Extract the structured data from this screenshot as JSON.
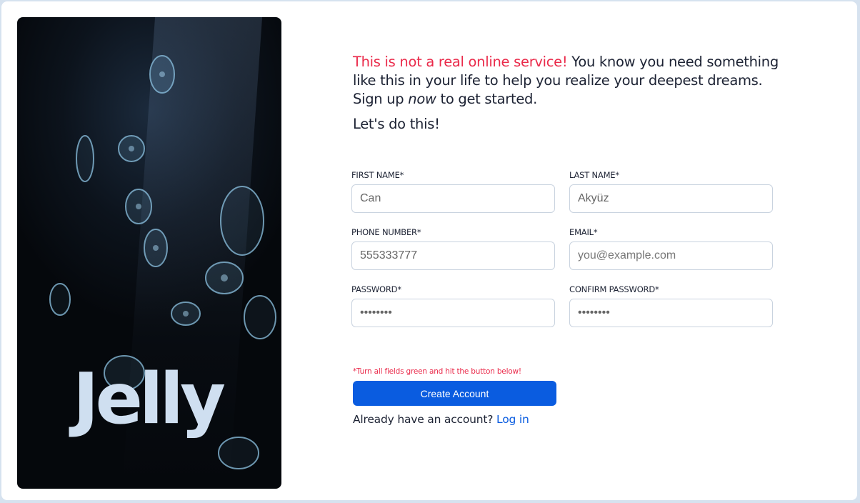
{
  "hero": {
    "brand": "Jelly",
    "image_alt": "jellyfish"
  },
  "intro": {
    "warning": "This is not a real online service!",
    "text_before_em": " You know you need something like this in your life to help you realize your deepest dreams. Sign up ",
    "em": "now",
    "text_after_em": " to get started.",
    "cta": "Let's do this!"
  },
  "form": {
    "first_name": {
      "label": "FIRST NAME*",
      "value": "Can",
      "placeholder": ""
    },
    "last_name": {
      "label": "LAST NAME*",
      "value": "Akyüz",
      "placeholder": ""
    },
    "phone": {
      "label": "PHONE NUMBER*",
      "value": "555333777",
      "placeholder": ""
    },
    "email": {
      "label": "EMAIL*",
      "value": "",
      "placeholder": "you@example.com"
    },
    "password": {
      "label": "PASSWORD*",
      "value": "********",
      "placeholder": ""
    },
    "confirm_password": {
      "label": "CONFIRM PASSWORD*",
      "value": "********",
      "placeholder": ""
    },
    "hint": "*Turn all fields green and hit the button below!",
    "submit_label": "Create Account"
  },
  "login": {
    "prompt": "Already have an account?",
    "link_label": "Log in"
  },
  "colors": {
    "accent": "#0a5ce0",
    "warning": "#ea2a4a",
    "text": "#1c2233"
  }
}
